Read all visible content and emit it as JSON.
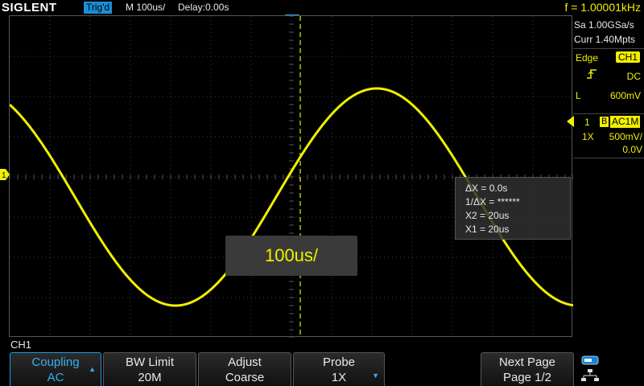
{
  "topbar": {
    "brand": "SIGLENT",
    "trigger_status": "Trig'd",
    "timebase": "M 100us/",
    "delay": "Delay:0.00s",
    "frequency": "f = 1.00001kHz"
  },
  "acquisition": {
    "sample_rate": "Sa 1.00GSa/s",
    "memory_depth": "Curr 1.40Mpts"
  },
  "trigger": {
    "type": "Edge",
    "source": "CH1",
    "coupling": "DC",
    "level_label": "L",
    "level_value": "600mV"
  },
  "channel1": {
    "number": "1",
    "bandwidth_flag": "B",
    "coupling": "AC1M",
    "probe": "1X",
    "scale": "500mV/",
    "offset": "0.0V",
    "marker": "1"
  },
  "cursor_measure": {
    "delta_x": "ΔX = 0.0s",
    "inv_delta_x": "1/ΔX = ******",
    "x2": "X2 = 20us",
    "x1": "X1 = 20us"
  },
  "timebase_popup": "100us/",
  "menu": {
    "title": "CH1",
    "keys": [
      {
        "line1": "Coupling",
        "line2": "AC"
      },
      {
        "line1": "BW Limit",
        "line2": "20M"
      },
      {
        "line1": "Adjust",
        "line2": "Coarse"
      },
      {
        "line1": "Probe",
        "line2": "1X"
      },
      {
        "line1": "Next Page",
        "line2": "Page 1/2"
      }
    ]
  },
  "colors": {
    "trace": "#f0f000",
    "accent": "#1f9bdf",
    "grid": "#3c3c3c"
  },
  "waveform": {
    "frequency_hz": 1000,
    "time_per_div_us": 100,
    "volts_per_div": 0.5,
    "amplitude_div": 2.7,
    "offset_div": -0.5
  }
}
